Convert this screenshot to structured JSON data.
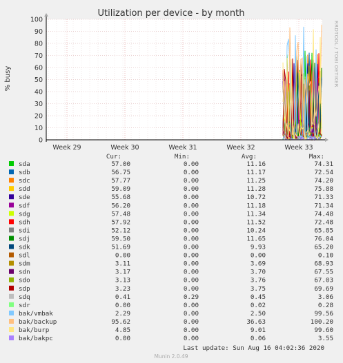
{
  "chart_data": {
    "type": "line",
    "title": "Utilization per device - by month",
    "ylabel": "% busy",
    "side_label": "RRDTOOL / TOBI OETIKER",
    "ylim": [
      0,
      100
    ],
    "yticks": [
      0,
      10,
      20,
      30,
      40,
      50,
      60,
      70,
      80,
      90,
      100
    ],
    "xticks": [
      "Week 29",
      "Week 30",
      "Week 31",
      "Week 32",
      "Week 33"
    ],
    "grid": true,
    "legend_headers": {
      "cur": "Cur:",
      "min": "Min:",
      "avg": "Avg:",
      "max": "Max:"
    },
    "series": [
      {
        "name": "sda",
        "color": "#00cc00",
        "cur": "57.00",
        "min": "0.00",
        "avg": "11.16",
        "max": "74.31"
      },
      {
        "name": "sdb",
        "color": "#0066b3",
        "cur": "56.75",
        "min": "0.00",
        "avg": "11.17",
        "max": "72.54"
      },
      {
        "name": "sdc",
        "color": "#ff8000",
        "cur": "57.77",
        "min": "0.00",
        "avg": "11.25",
        "max": "74.20"
      },
      {
        "name": "sdd",
        "color": "#ffcc00",
        "cur": "59.09",
        "min": "0.00",
        "avg": "11.28",
        "max": "75.88"
      },
      {
        "name": "sde",
        "color": "#330099",
        "cur": "55.68",
        "min": "0.00",
        "avg": "10.72",
        "max": "71.33"
      },
      {
        "name": "sdf",
        "color": "#990099",
        "cur": "56.20",
        "min": "0.00",
        "avg": "11.18",
        "max": "71.34"
      },
      {
        "name": "sdg",
        "color": "#ccff00",
        "cur": "57.48",
        "min": "0.00",
        "avg": "11.34",
        "max": "74.48"
      },
      {
        "name": "sdh",
        "color": "#ff0000",
        "cur": "57.92",
        "min": "0.00",
        "avg": "11.52",
        "max": "72.48"
      },
      {
        "name": "sdi",
        "color": "#808080",
        "cur": "52.12",
        "min": "0.00",
        "avg": "10.24",
        "max": "65.85"
      },
      {
        "name": "sdj",
        "color": "#008f00",
        "cur": "59.50",
        "min": "0.00",
        "avg": "11.65",
        "max": "76.04"
      },
      {
        "name": "sdk",
        "color": "#00487d",
        "cur": "51.69",
        "min": "0.00",
        "avg": "9.93",
        "max": "65.20"
      },
      {
        "name": "sdl",
        "color": "#b35a00",
        "cur": "0.00",
        "min": "0.00",
        "avg": "0.00",
        "max": "0.10"
      },
      {
        "name": "sdm",
        "color": "#b38f00",
        "cur": "3.11",
        "min": "0.00",
        "avg": "3.69",
        "max": "68.93"
      },
      {
        "name": "sdn",
        "color": "#6b006b",
        "cur": "3.17",
        "min": "0.00",
        "avg": "3.70",
        "max": "67.55"
      },
      {
        "name": "sdo",
        "color": "#8fb300",
        "cur": "3.13",
        "min": "0.00",
        "avg": "3.76",
        "max": "67.03"
      },
      {
        "name": "sdp",
        "color": "#b30000",
        "cur": "3.23",
        "min": "0.00",
        "avg": "3.75",
        "max": "69.69"
      },
      {
        "name": "sdq",
        "color": "#bebebe",
        "cur": "0.41",
        "min": "0.29",
        "avg": "0.45",
        "max": "3.06"
      },
      {
        "name": "sdr",
        "color": "#80ff80",
        "cur": "0.00",
        "min": "0.00",
        "avg": "0.02",
        "max": "0.28"
      },
      {
        "name": "bak/vmbak",
        "color": "#80c9ff",
        "cur": "2.29",
        "min": "0.00",
        "avg": "2.50",
        "max": "99.56"
      },
      {
        "name": "bak/backup",
        "color": "#ffc080",
        "cur": "95.62",
        "min": "0.00",
        "avg": "36.63",
        "max": "100.20"
      },
      {
        "name": "bak/burp",
        "color": "#ffe680",
        "cur": "4.85",
        "min": "0.00",
        "avg": "9.01",
        "max": "99.60"
      },
      {
        "name": "bak/bakpc",
        "color": "#aa80ff",
        "cur": "0.00",
        "min": "0.00",
        "avg": "0.06",
        "max": "3.55"
      }
    ],
    "footer": "Last update: Sun Aug 16 04:02:36 2020",
    "generator": "Munin 2.0.49"
  }
}
